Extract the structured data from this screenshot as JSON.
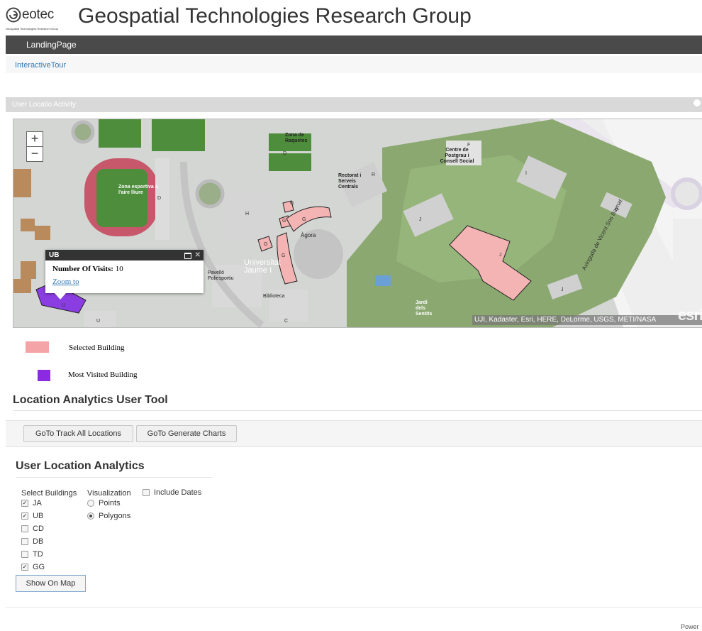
{
  "header": {
    "logo_text": "eotec",
    "logo_sub": "Geospatial Technologies Research Group",
    "title": "Geospatial Technologies Research Group"
  },
  "nav": {
    "landing": "LandingPage",
    "tour": "InteractiveTour"
  },
  "panel": {
    "title": "User Locatio Activity"
  },
  "map": {
    "zoom_in": "+",
    "zoom_out": "−",
    "attribution": "UJI, Kadaster, Esri, HERE, DeLorme, USGS, METI/NASA",
    "esri": "esri",
    "labels": {
      "raquetes": "Zona de Raquetes",
      "esportiva": "Zona esportiva a l'aire lliure",
      "rectorat": "Rectorat i Serveis Centrals",
      "postgrau": "Centre de Postgrau i Consell Social",
      "agora": "Àgora",
      "uji": "Universitat Jaume I",
      "pavello": "Pavelló Poliesportiu",
      "biblioteca": "Biblioteca",
      "jardi": "Jardí dels Sentits",
      "street": "Avinguda de Vicent Sos Baynat"
    },
    "building_letters": [
      "D",
      "F",
      "R",
      "I",
      "A",
      "H",
      "G",
      "J",
      "C",
      "U"
    ],
    "popup": {
      "title": "UB",
      "visits_label": "Number Of Visits:",
      "visits_value": "10",
      "zoom_link": "Zoom to"
    },
    "colors": {
      "selected": "#f4b4b4",
      "most_visited": "#8a3de0"
    }
  },
  "legend": [
    {
      "label": "Selected Building",
      "color": "#f4a3a6"
    },
    {
      "label": "Most Visited Building",
      "color": "#8a2be2"
    }
  ],
  "tool": {
    "title": "Location Analytics User Tool",
    "track_button": "GoTo Track All Locations",
    "charts_button": "GoTo Generate Charts"
  },
  "analytics": {
    "title": "User Location Analytics",
    "buildings_label": "Select Buildings",
    "visualization_label": "Visualization",
    "include_dates_label": "Include Dates",
    "buildings": [
      {
        "label": "JA",
        "checked": true
      },
      {
        "label": "UB",
        "checked": true
      },
      {
        "label": "CD",
        "checked": false
      },
      {
        "label": "DB",
        "checked": false
      },
      {
        "label": "TD",
        "checked": false
      },
      {
        "label": "GG",
        "checked": true
      }
    ],
    "visualizations": [
      {
        "label": "Points",
        "selected": false
      },
      {
        "label": "Polygons",
        "selected": true
      }
    ],
    "show_button": "Show On Map"
  },
  "footer": {
    "text": "Power"
  }
}
